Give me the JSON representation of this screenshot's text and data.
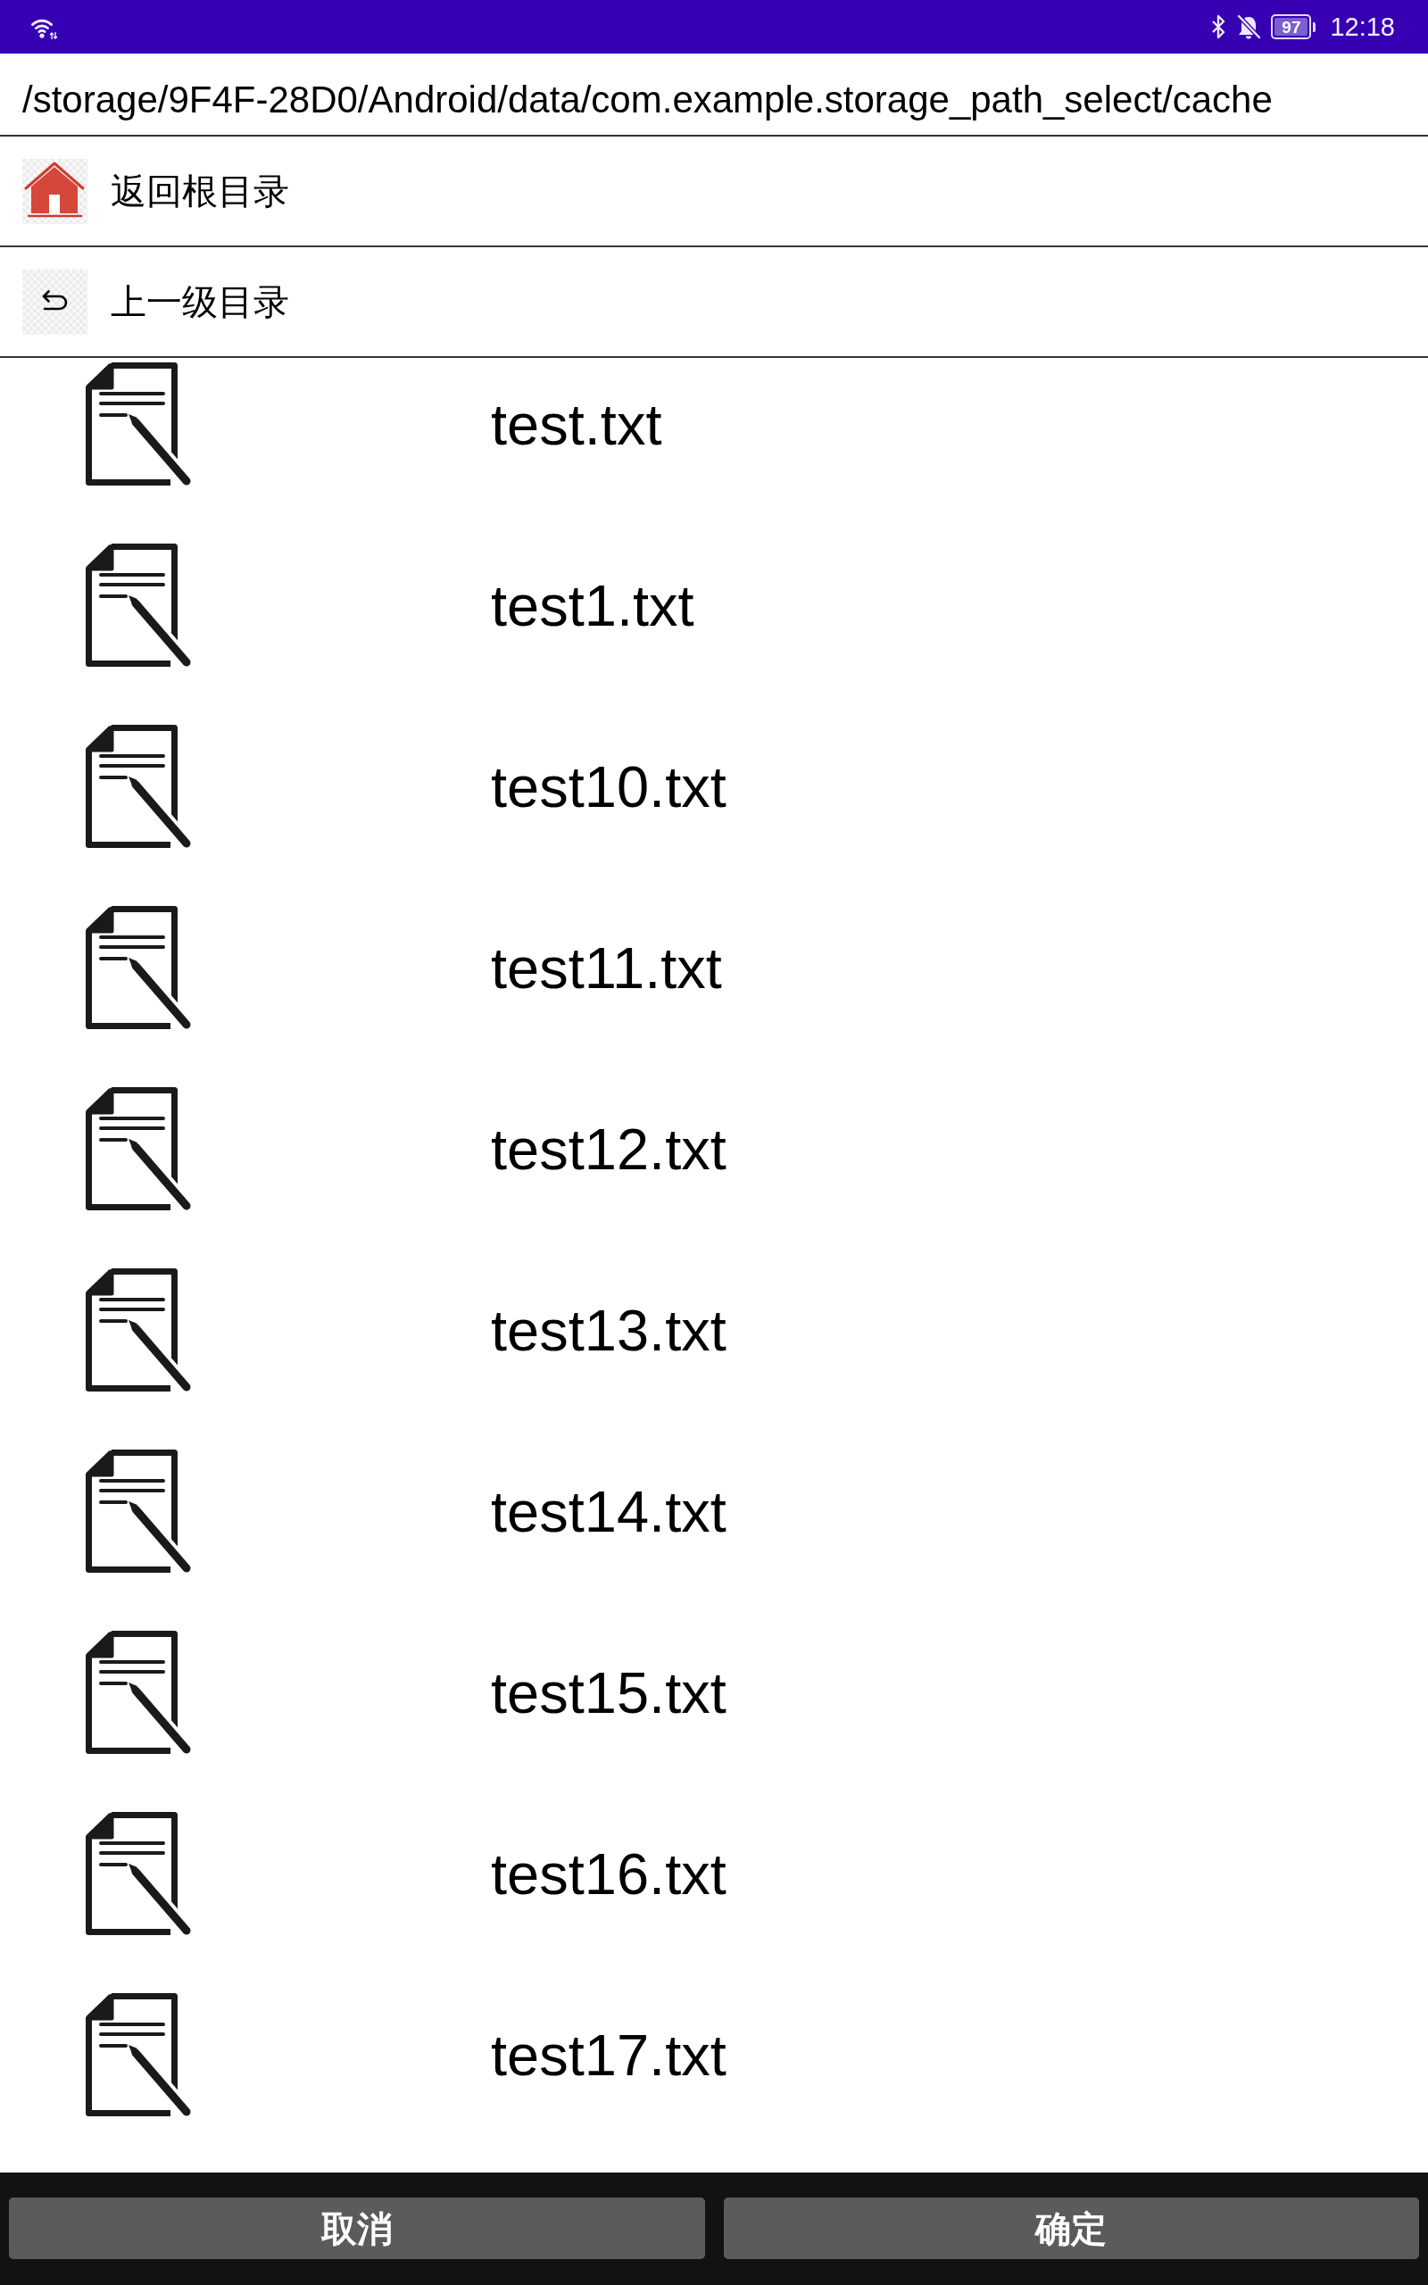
{
  "status_bar": {
    "battery": "97",
    "time": "12:18"
  },
  "path": "/storage/9F4F-28D0/Android/data/com.example.storage_path_select/cache",
  "nav_items": [
    {
      "kind": "home",
      "label": "返回根目录"
    },
    {
      "kind": "up",
      "label": "上一级目录"
    }
  ],
  "files": [
    {
      "name": "test.txt"
    },
    {
      "name": "test1.txt"
    },
    {
      "name": "test10.txt"
    },
    {
      "name": "test11.txt"
    },
    {
      "name": "test12.txt"
    },
    {
      "name": "test13.txt"
    },
    {
      "name": "test14.txt"
    },
    {
      "name": "test15.txt"
    },
    {
      "name": "test16.txt"
    },
    {
      "name": "test17.txt"
    }
  ],
  "buttons": [
    {
      "label": "取消"
    },
    {
      "label": "确定"
    }
  ]
}
